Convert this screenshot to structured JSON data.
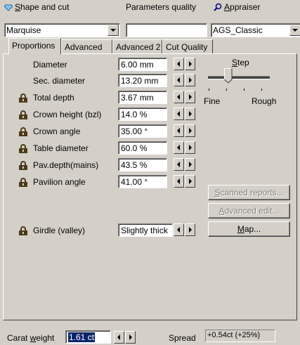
{
  "header": {
    "shape_label": "Shape and cut",
    "shape_value": "Marquise",
    "quality_label": "Parameters quality",
    "quality_value": "",
    "appraiser_label": "Appraiser",
    "appraiser_value": "AGS_Classic"
  },
  "tabs": [
    {
      "label": "Proportions",
      "active": true
    },
    {
      "label": "Advanced",
      "active": false
    },
    {
      "label": "Advanced 2",
      "active": false
    },
    {
      "label": "Cut Quality",
      "active": false
    }
  ],
  "params": [
    {
      "label": "Diameter",
      "value": "6.00 mm",
      "locked": false
    },
    {
      "label": "Sec. diameter",
      "value": "13.20 mm",
      "locked": false
    },
    {
      "label": "Total depth",
      "value": "3.67 mm",
      "locked": true
    },
    {
      "label": "Crown height (bzl)",
      "value": "14.0 %",
      "locked": true
    },
    {
      "label": "Crown angle",
      "value": "35.00 °",
      "locked": true
    },
    {
      "label": "Table diameter",
      "value": "60.0 %",
      "locked": true
    },
    {
      "label": "Pav.depth(mains)",
      "value": "43.5 %",
      "locked": true
    },
    {
      "label": "Pavilion angle",
      "value": "41.00 °",
      "locked": true
    }
  ],
  "girdle": {
    "label": "Girdle (valley)",
    "value": "Slightly thick"
  },
  "step": {
    "label": "Step",
    "fine_label": "Fine",
    "rough_label": "Rough",
    "position": 0.33
  },
  "buttons": {
    "scanned_reports": "Scanned reports...",
    "advanced_edit": "Advanced edit...",
    "map": "Map..."
  },
  "footer": {
    "carat_label": "Carat weight",
    "carat_value": "1.61 ct",
    "spread_label": "Spread",
    "spread_value": "+0.54ct (+25%)"
  },
  "colors": {
    "face": "#d4d0c8",
    "highlight": "#0a246a",
    "lock": "#4a3a1a"
  }
}
